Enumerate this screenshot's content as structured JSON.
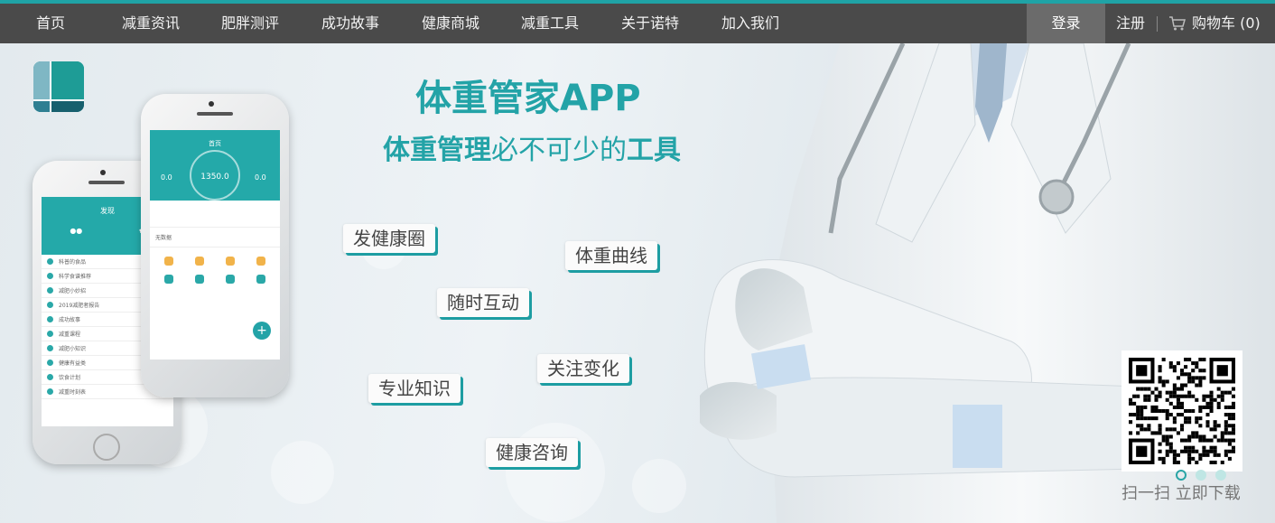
{
  "nav": {
    "items": [
      "首页",
      "减重资讯",
      "肥胖测评",
      "成功故事",
      "健康商城",
      "减重工具",
      "关于诺特",
      "加入我们"
    ],
    "login": "登录",
    "register": "注册",
    "cart": "购物车 (0)"
  },
  "banner": {
    "headline": "体重管家APP",
    "subline_part1": "体重管理",
    "subline_part2": "必不可少的",
    "subline_part3": "工具",
    "tags": [
      "发健康圈",
      "体重曲线",
      "随时互动",
      "关注变化",
      "专业知识",
      "健康咨询"
    ],
    "qr_caption": "扫一扫 立即下载",
    "carousel_active_index": 0,
    "carousel_count": 3
  },
  "phone_back": {
    "title": "发现",
    "menu_items": [
      "科普的食品",
      "科学食谱推荐",
      "减肥小妙招",
      "2019减肥者报告",
      "成功故事",
      "减重课程",
      "减肥小知识",
      "健康有益类",
      "饮食计划",
      "减重时刻表"
    ]
  },
  "phone_front": {
    "title": "首页",
    "center_value": "1350.0",
    "left_value": "0.0",
    "right_value": "0.0",
    "weight_value": "无数据"
  },
  "colors": {
    "accent": "#23a3a7",
    "nav_bg": "#4a4a4a",
    "login_bg": "#6b6b6b"
  }
}
